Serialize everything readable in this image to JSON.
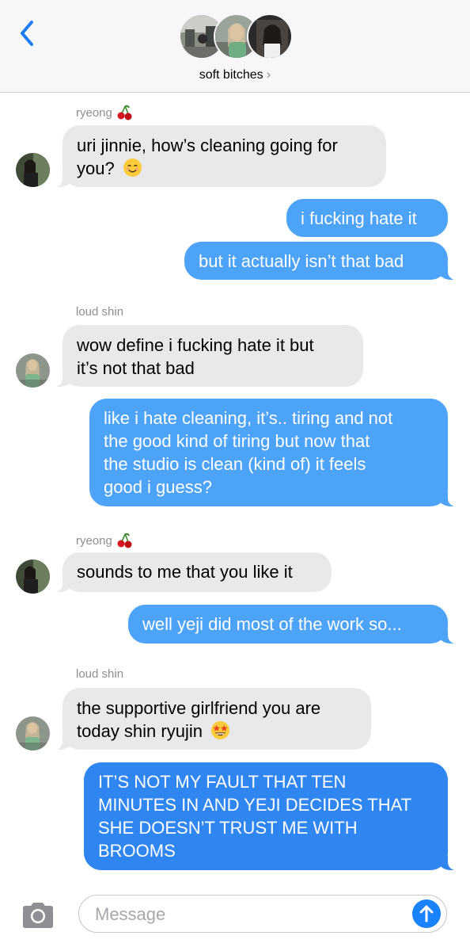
{
  "header": {
    "back_icon": "chevron-left-icon",
    "group_name": "soft bitches",
    "chevron": "›",
    "accent": "#007aff"
  },
  "messages": [
    {
      "type": "sender",
      "name": "ryeong",
      "emoji": "cherry-icon"
    },
    {
      "type": "in",
      "lines": [
        "uri jinnie, how’s cleaning going for",
        "you?"
      ],
      "emoji": "smiling-face-icon"
    },
    {
      "type": "out",
      "lines": [
        "i fucking hate it"
      ]
    },
    {
      "type": "out",
      "lines": [
        "but it actually isn’t that bad"
      ]
    },
    {
      "type": "sender",
      "name": "loud shin"
    },
    {
      "type": "in",
      "lines": [
        "wow define i fucking hate it but",
        "it’s not that bad"
      ]
    },
    {
      "type": "out",
      "lines": [
        "like i hate cleaning, it’s.. tiring and not",
        "the good kind of tiring but now that",
        "the studio is clean (kind of) it feels",
        "good i guess?"
      ]
    },
    {
      "type": "sender",
      "name": "ryeong",
      "emoji": "cherry-icon"
    },
    {
      "type": "in",
      "lines": [
        "sounds to me that you like it"
      ]
    },
    {
      "type": "out",
      "lines": [
        "well yeji did most of the work so..."
      ]
    },
    {
      "type": "sender",
      "name": "loud shin"
    },
    {
      "type": "in",
      "lines": [
        "the supportive girlfriend you are",
        "today shin ryujin"
      ],
      "emoji": "star-struck-icon"
    },
    {
      "type": "out",
      "lines": [
        "IT’S NOT MY FAULT THAT TEN",
        "MINUTES IN AND YEJI DECIDES THAT",
        "SHE DOESN’T TRUST ME WITH",
        "BROOMS"
      ]
    }
  ],
  "input": {
    "placeholder": "Message",
    "value": "",
    "camera_icon": "camera-icon",
    "send_icon": "arrow-up-icon"
  },
  "colors": {
    "incoming_bubble": "#e9e9eb",
    "outgoing_bubble": "#4da3f8",
    "send_button": "#1a82fb"
  }
}
